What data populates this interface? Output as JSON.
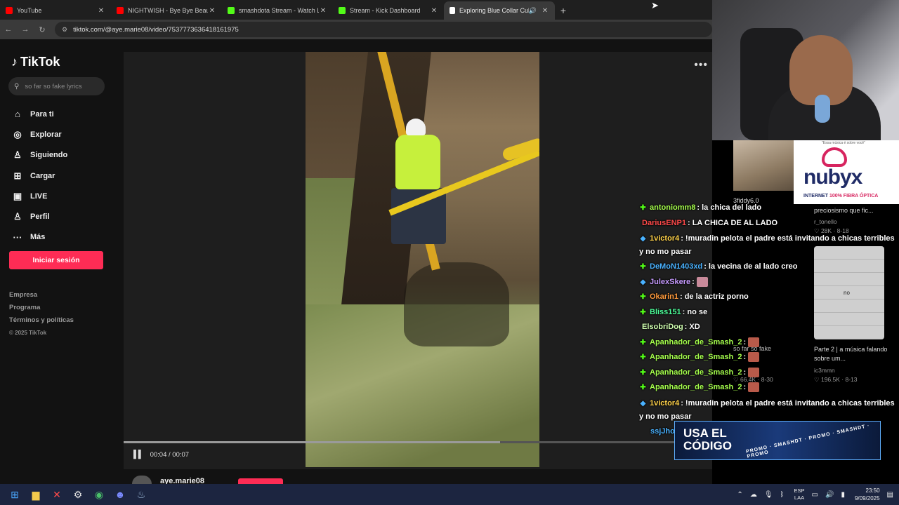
{
  "browser": {
    "tabs": [
      {
        "title": "YouTube",
        "color": "#ff0000"
      },
      {
        "title": "NIGHTWISH - Bye Bye Beautiful",
        "color": "#ff0000"
      },
      {
        "title": "smashdota Stream - Watch Live",
        "color": "#53fc18"
      },
      {
        "title": "Stream - Kick Dashboard",
        "color": "#53fc18"
      },
      {
        "title": "Exploring Blue Collar Cultu",
        "color": "#ffffff"
      }
    ],
    "url": "tiktok.com/@aye.marie08/video/7537773636418161975"
  },
  "tiktok": {
    "logo": "TikTok",
    "search_placeholder": "so far so fake lyrics",
    "nav": [
      {
        "label": "Para ti",
        "icon": "home-icon"
      },
      {
        "label": "Explorar",
        "icon": "compass-icon"
      },
      {
        "label": "Siguiendo",
        "icon": "user-icon"
      },
      {
        "label": "Cargar",
        "icon": "plus-square-icon"
      },
      {
        "label": "LIVE",
        "icon": "live-icon"
      },
      {
        "label": "Perfil",
        "icon": "profile-icon"
      },
      {
        "label": "Más",
        "icon": "more-icon"
      }
    ],
    "login_label": "Iniciar sesión",
    "footer": [
      "Empresa",
      "Programa",
      "Términos y políticas"
    ],
    "copyright": "© 2025 TikTok",
    "video": {
      "time": "00:04 / 00:07",
      "progress": 0.64,
      "author": "aye.marie08"
    },
    "related": {
      "item1_title": "preciosismo que fic...",
      "item1_user": "r_tonello",
      "item1_likes": "♡ 28K · 8-18",
      "item2_title": "Parte 2 | a música falando sobre um...",
      "item2_user": "ic3mmn",
      "item2_likes": "♡ 196.5K · 8-13",
      "thumb_text": "no",
      "left_title": "so far so fake",
      "left_user": "3fiddy6.0",
      "left_likes": "♡ 66.4K · 8-30"
    }
  },
  "ad": {
    "tag": "\"Essa música é sobre você\"",
    "brand": "nubyx",
    "tagline_a": "INTERNET ",
    "tagline_b": "100% FIBRA ÓPTICA"
  },
  "chat": [
    {
      "user": "antoniomm8",
      "color": "#a6ff4d",
      "text": ": la chica del lado"
    },
    {
      "user": "DariusENP1",
      "color": "#ff4a4a",
      "text": ": LA CHICA DE AL LADO"
    },
    {
      "user": "1victor4",
      "color": "#ffd24a",
      "text": ": !muradin pelota el padre está invitando a chicas terribles y no mo pasar"
    },
    {
      "user": "DeMoN1403xd",
      "color": "#4ab2ff",
      "text": ": la vecina de al lado creo"
    },
    {
      "user": "JulexSkere",
      "color": "#c79bff",
      "text": ":"
    },
    {
      "user": "Okarin1",
      "color": "#ff9a3c",
      "text": ": de la actriz porno"
    },
    {
      "user": "Bliss151",
      "color": "#4dff9a",
      "text": ": no se"
    },
    {
      "user": "ElsobriDog",
      "color": "#d0ffb0",
      "text": ": XD"
    },
    {
      "user": "Apanhador_de_Smash_2",
      "color": "#a6ff4d",
      "text": ":"
    },
    {
      "user": "Apanhador_de_Smash_2",
      "color": "#a6ff4d",
      "text": ":"
    },
    {
      "user": "Apanhador_de_Smash_2",
      "color": "#a6ff4d",
      "text": ":"
    },
    {
      "user": "Apanhador_de_Smash_2",
      "color": "#a6ff4d",
      "text": ":"
    },
    {
      "user": "1victor4",
      "color": "#ffd24a",
      "text": ": !muradin pelota el padre está invitando a chicas terribles y no mo pasar"
    },
    {
      "user": "ssjJho",
      "color": "#4ab2ff",
      "text": ""
    }
  ],
  "promo": {
    "line1": "USA EL",
    "line2": "CÓDIGO",
    "strip": "PROMO · SMASHDT · PROMO · SMASHDT · PROMO"
  },
  "taskbar": {
    "lang_a": "ESP",
    "lang_b": "LAA",
    "time": "23:50",
    "date": "9/09/2025"
  }
}
